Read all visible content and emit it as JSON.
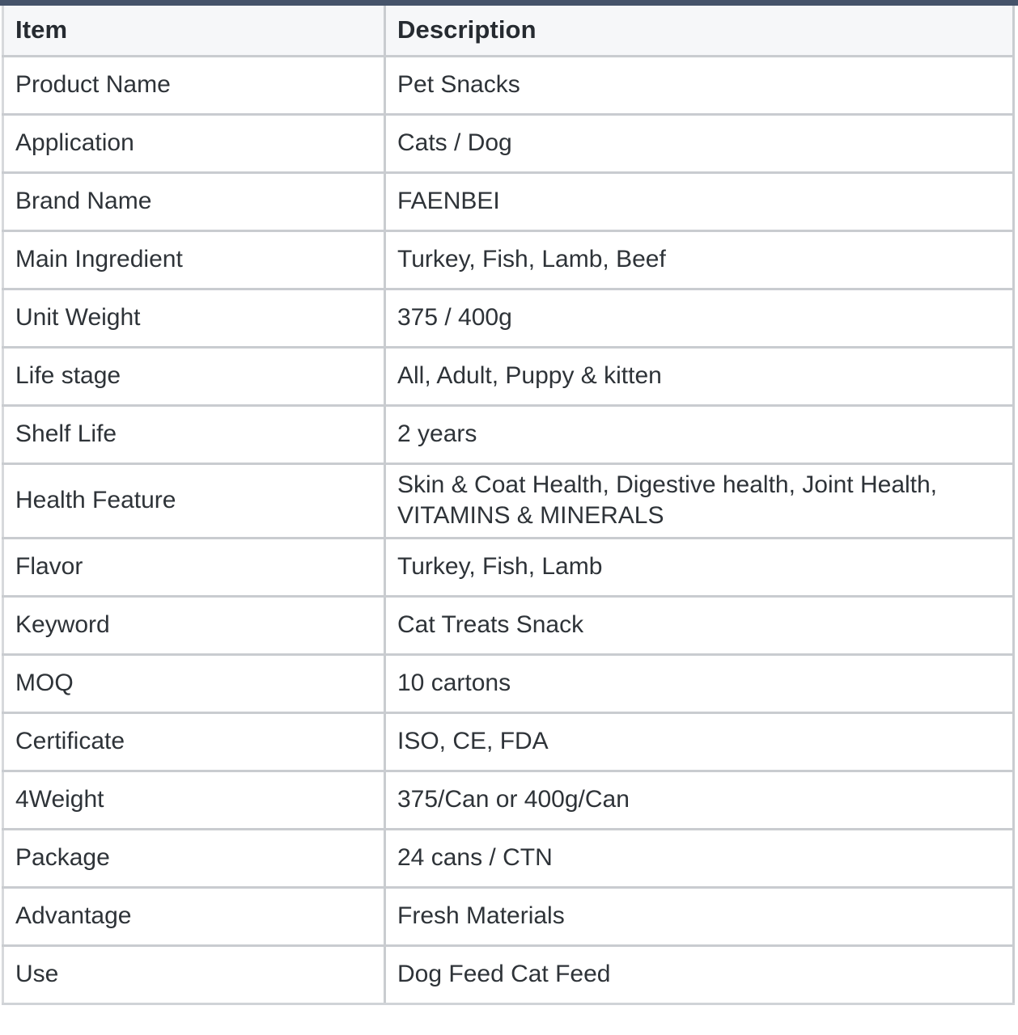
{
  "document": {
    "type": "product-specification-table",
    "accent_top_bar_color": "#45536a",
    "header_background_color": "#f6f7f9",
    "border_color": "#c9ccd0",
    "text_color": "#2e3338"
  },
  "table": {
    "columns": [
      {
        "key": "item",
        "label": "Item"
      },
      {
        "key": "description",
        "label": "Description"
      }
    ],
    "rows": [
      {
        "item": "Product Name",
        "description": "Pet Snacks"
      },
      {
        "item": "Application",
        "description": "Cats / Dog"
      },
      {
        "item": "Brand Name",
        "description": "FAENBEI"
      },
      {
        "item": "Main Ingredient",
        "description": "Turkey, Fish, Lamb, Beef"
      },
      {
        "item": "Unit Weight",
        "description": "375 / 400g"
      },
      {
        "item": "Life stage",
        "description": "All, Adult, Puppy & kitten"
      },
      {
        "item": "Shelf Life",
        "description": "2 years"
      },
      {
        "item": "Health Feature",
        "description": "Skin & Coat Health, Digestive health, Joint Health, VITAMINS & MINERALS"
      },
      {
        "item": "Flavor",
        "description": "Turkey, Fish, Lamb"
      },
      {
        "item": "Keyword",
        "description": "Cat Treats Snack"
      },
      {
        "item": "MOQ",
        "description": "10 cartons"
      },
      {
        "item": "Certificate",
        "description": "ISO, CE, FDA"
      },
      {
        "item": "4Weight",
        "description": "375/Can or 400g/Can"
      },
      {
        "item": "Package",
        "description": "24 cans / CTN"
      },
      {
        "item": "Advantage",
        "description": "Fresh Materials"
      },
      {
        "item": "Use",
        "description": "Dog Feed Cat Feed"
      }
    ]
  }
}
